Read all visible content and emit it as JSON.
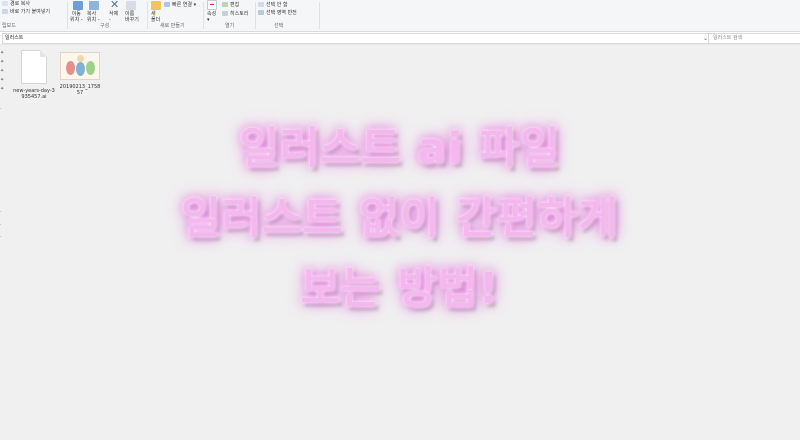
{
  "ribbon": {
    "clipboard": {
      "copy_path": "경로 복사",
      "paste_shortcut": "바로 가기 붙여넣기",
      "label": "립보드"
    },
    "organize": {
      "move_to": "이동",
      "move_to2": "위치 -",
      "copy_to": "복사",
      "copy_to2": "위치 -",
      "delete": "삭제",
      "delete2": "-",
      "rename": "이름",
      "rename2": "바꾸기",
      "label": "구성"
    },
    "new": {
      "new_folder": "새",
      "new_folder2": "폴더",
      "easy_access": "빠른 연결",
      "label": "새로 만들기"
    },
    "open": {
      "properties": "속성",
      "edit": "편집",
      "history": "히스토리",
      "label": "열기"
    },
    "select": {
      "select_all": "선택 안 함",
      "invert": "선택 영역 반전",
      "label": "선택"
    }
  },
  "address": {
    "path": "일러스트",
    "search_placeholder": "일러스트 검색",
    "refresh": "↻",
    "chevron": "⌄"
  },
  "files": [
    {
      "name_line1": "new-years-day-3",
      "name_line2": "935457.ai"
    },
    {
      "name_line1": "20190213_1758",
      "name_line2": "57"
    }
  ],
  "overlay": {
    "line1": "일러스트 ai 파일",
    "line2": "일러스트 없이 간편하게",
    "line3": "보는 방법!"
  },
  "colors": {
    "overlay_text": "#f4b8ef",
    "glow": "#e070d8",
    "background": "#f0f0f0"
  }
}
